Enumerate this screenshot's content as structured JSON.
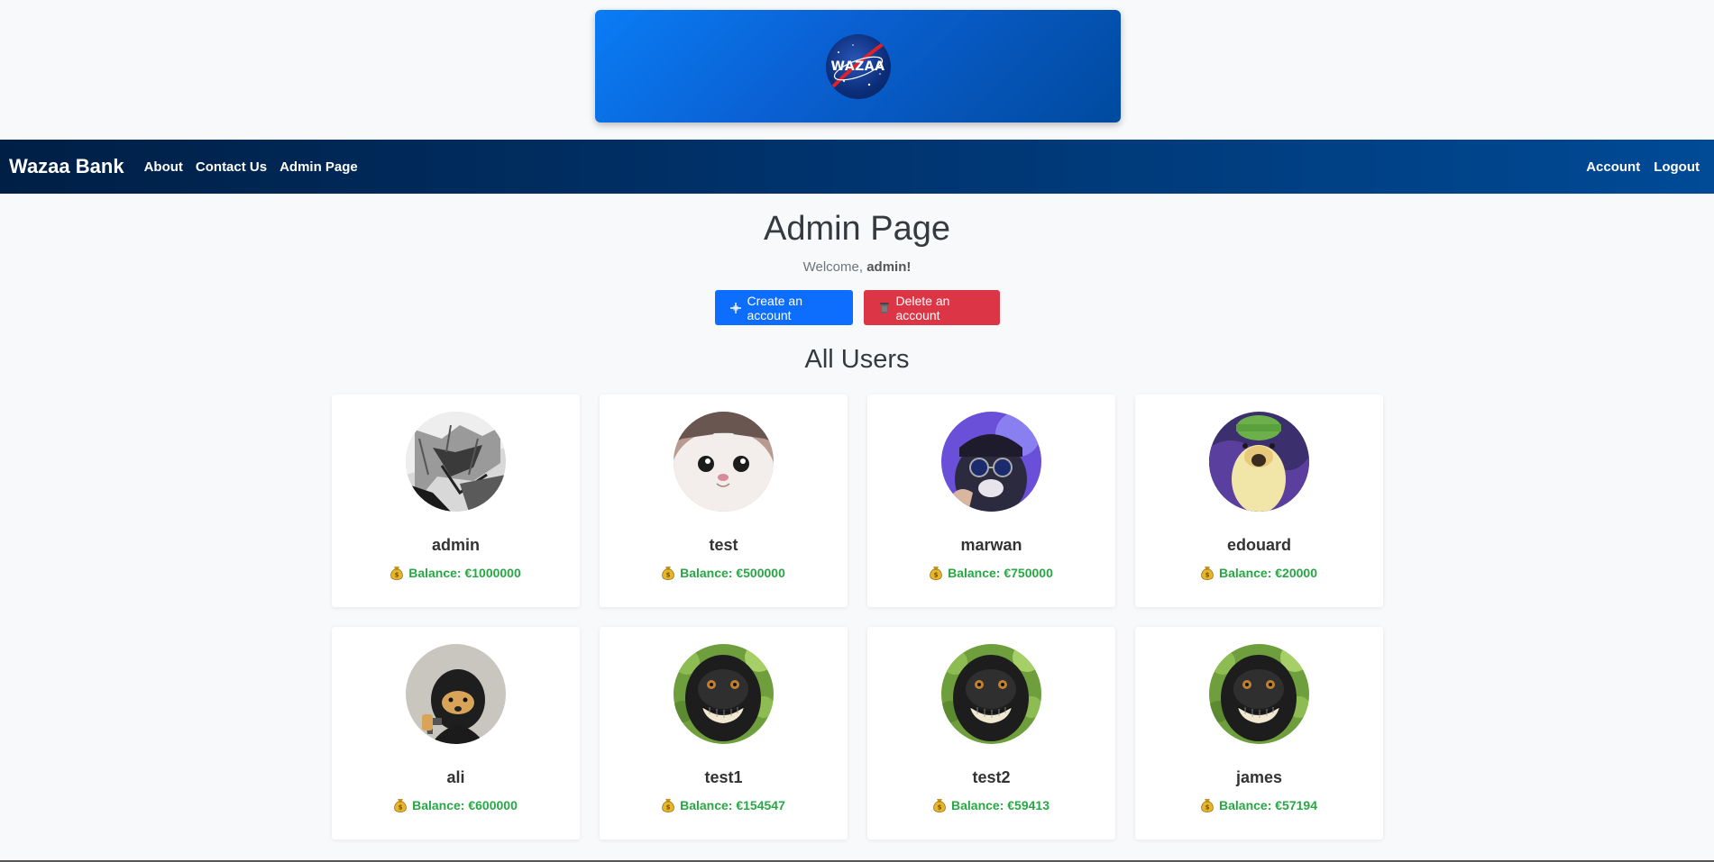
{
  "banner": {
    "logo_text": "WAZAA"
  },
  "nav": {
    "brand": "Wazaa Bank",
    "links": [
      "About",
      "Contact Us",
      "Admin Page"
    ],
    "right_links": [
      "Account",
      "Logout"
    ]
  },
  "page": {
    "title": "Admin Page",
    "welcome_prefix": "Welcome, ",
    "welcome_user": "admin",
    "welcome_suffix": "!",
    "create_button": "Create an account",
    "delete_button": "Delete an account",
    "section_title": "All Users"
  },
  "users": [
    {
      "name": "admin",
      "balance": "Balance: €1000000",
      "avatar": "manga-avatar"
    },
    {
      "name": "test",
      "balance": "Balance: €500000",
      "avatar": "cat-avatar"
    },
    {
      "name": "marwan",
      "balance": "Balance: €750000",
      "avatar": "cool-cat-avatar"
    },
    {
      "name": "edouard",
      "balance": "Balance: €20000",
      "avatar": "duck-avatar"
    },
    {
      "name": "ali",
      "balance": "Balance: €600000",
      "avatar": "masked-dog-avatar"
    },
    {
      "name": "test1",
      "balance": "Balance: €154547",
      "avatar": "monkey-avatar"
    },
    {
      "name": "test2",
      "balance": "Balance: €59413",
      "avatar": "monkey-avatar"
    },
    {
      "name": "james",
      "balance": "Balance: €57194",
      "avatar": "monkey-avatar"
    }
  ],
  "colors": {
    "navbar_start": "#001f45",
    "navbar_end": "#004a96",
    "create_button": "#0d6efd",
    "delete_button": "#dc3545",
    "balance_text": "#28a745"
  }
}
